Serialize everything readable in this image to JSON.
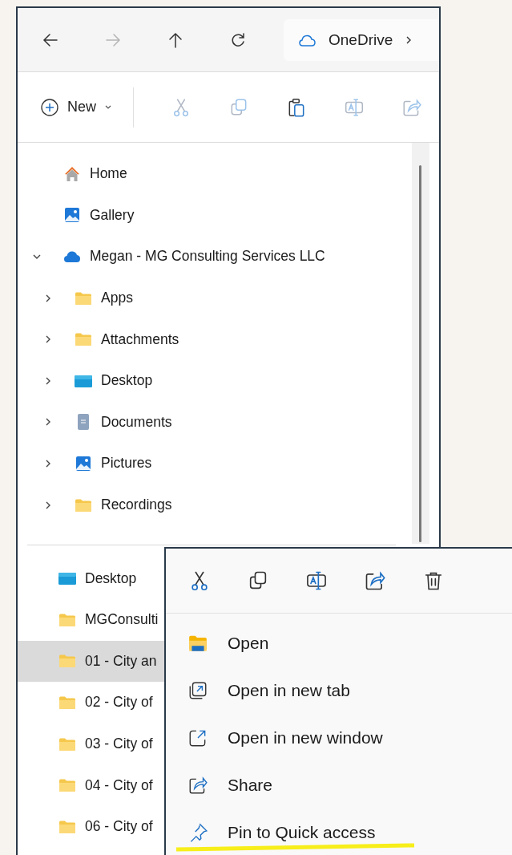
{
  "nav_buttons": [
    {
      "kind": "back",
      "disabled": false
    },
    {
      "kind": "forward",
      "disabled": true
    },
    {
      "kind": "up",
      "disabled": false
    },
    {
      "kind": "refresh",
      "disabled": false
    }
  ],
  "address_bar": {
    "location": "OneDrive"
  },
  "toolbar": {
    "new_label": "New",
    "actions": [
      {
        "kind": "cut",
        "disabled": true
      },
      {
        "kind": "copy",
        "disabled": true
      },
      {
        "kind": "paste",
        "disabled": false
      },
      {
        "kind": "rename",
        "disabled": true
      },
      {
        "kind": "share",
        "disabled": true
      }
    ]
  },
  "nav_tree": [
    {
      "label": "Home",
      "kind": "home"
    },
    {
      "label": "Gallery",
      "kind": "gallery"
    },
    {
      "label": "Megan - MG Consulting Services LLC",
      "kind": "cloud",
      "expanded": true,
      "children": [
        {
          "label": "Apps",
          "kind": "folder",
          "expanded": false
        },
        {
          "label": "Attachments",
          "kind": "folder",
          "expanded": false
        },
        {
          "label": "Desktop",
          "kind": "desktop",
          "expanded": false
        },
        {
          "label": "Documents",
          "kind": "documents",
          "expanded": false
        },
        {
          "label": "Pictures",
          "kind": "pictures",
          "expanded": false
        },
        {
          "label": "Recordings",
          "kind": "folder",
          "expanded": false
        }
      ]
    }
  ],
  "quick_access": [
    {
      "label": "Desktop",
      "kind": "desktop",
      "selected": false
    },
    {
      "label": "MGConsulti",
      "kind": "folder",
      "selected": false
    },
    {
      "label": "01 - City an",
      "kind": "folder",
      "selected": true
    },
    {
      "label": "02 - City of",
      "kind": "folder",
      "selected": false
    },
    {
      "label": "03 - City of",
      "kind": "folder",
      "selected": false
    },
    {
      "label": "04 - City of",
      "kind": "folder",
      "selected": false
    },
    {
      "label": "06 - City of",
      "kind": "folder",
      "selected": false
    }
  ],
  "context_menu": {
    "actions": [
      {
        "kind": "cut"
      },
      {
        "kind": "copy"
      },
      {
        "kind": "rename"
      },
      {
        "kind": "share"
      },
      {
        "kind": "delete"
      }
    ],
    "items": [
      {
        "label": "Open",
        "kind": "open",
        "highlighted": false
      },
      {
        "label": "Open in new tab",
        "kind": "new-tab",
        "highlighted": false
      },
      {
        "label": "Open in new window",
        "kind": "new-window",
        "highlighted": false
      },
      {
        "label": "Share",
        "kind": "share",
        "highlighted": false
      },
      {
        "label": "Pin to Quick access",
        "kind": "pin",
        "highlighted": true
      }
    ]
  }
}
